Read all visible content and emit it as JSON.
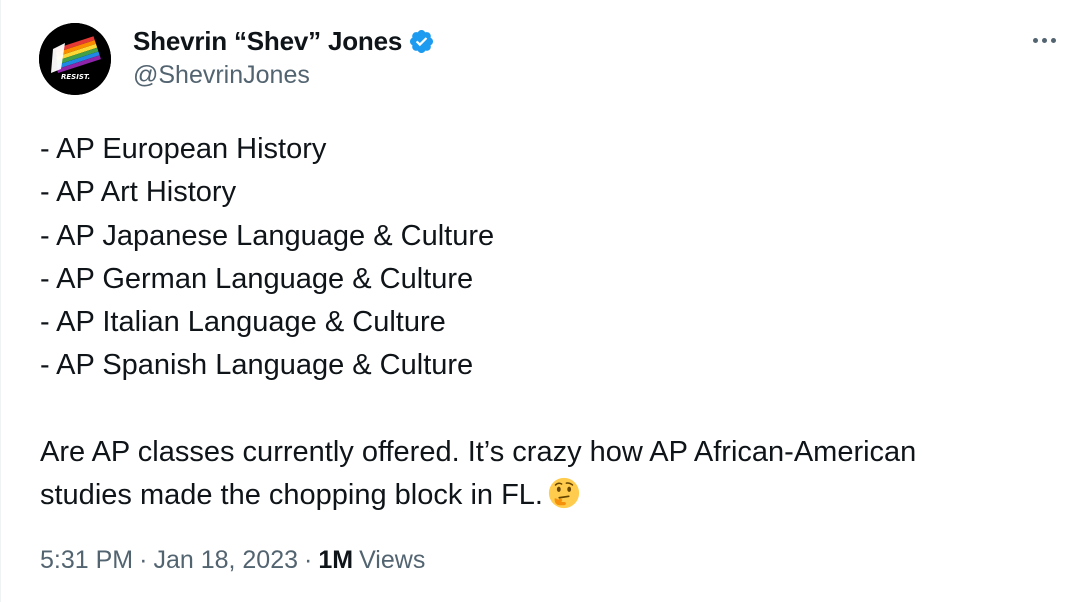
{
  "author": {
    "display_name": "Shevrin “Shev” Jones",
    "handle": "@ShevrinJones",
    "verified": true,
    "avatar_text": "RESIST."
  },
  "tweet": {
    "lines": [
      "- AP European History",
      "- AP Art History",
      "- AP Japanese Language & Culture",
      "- AP German Language & Culture",
      "- AP Italian Language & Culture",
      "- AP Spanish Language & Culture",
      "",
      "Are AP classes currently offered. It’s crazy how AP African-American",
      "studies made the chopping block in FL."
    ],
    "emoji": "thinking-face"
  },
  "meta": {
    "time": "5:31 PM",
    "date": "Jan 18, 2023",
    "separator": "·",
    "views_count": "1M",
    "views_label": "Views"
  },
  "colors": {
    "text": "#0f1419",
    "secondary": "#536471",
    "verified": "#1d9bf0"
  }
}
